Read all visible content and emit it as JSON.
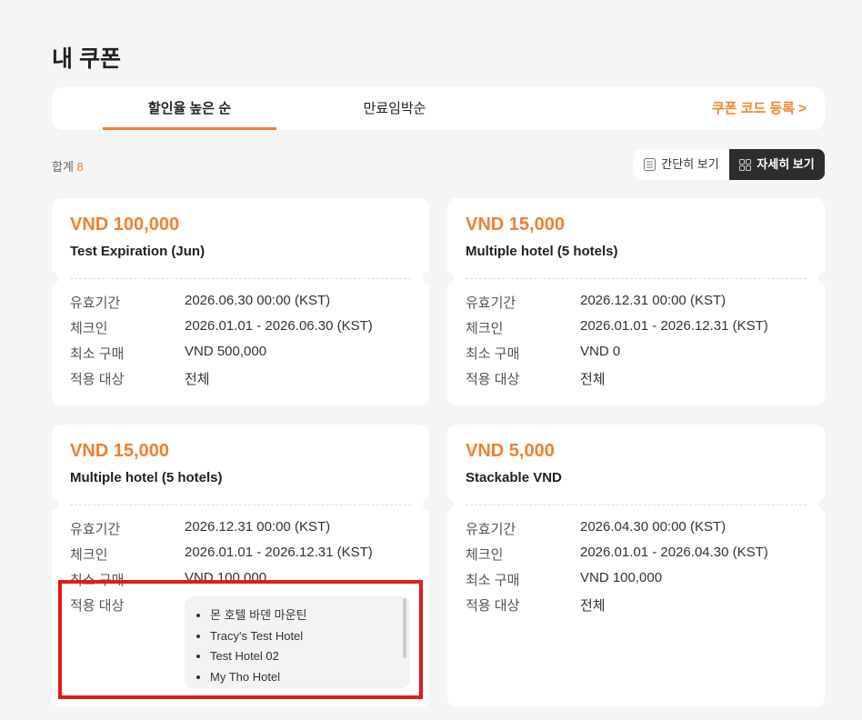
{
  "title": "내 쿠폰",
  "tabs": [
    {
      "label": "할인율 높은 순",
      "active": true
    },
    {
      "label": "만료임박순",
      "active": false
    }
  ],
  "register_label": "쿠폰 코드 등록 >",
  "total": {
    "label": "합계",
    "count": "8"
  },
  "view_toggle": {
    "simple": "간단히 보기",
    "detail": "자세히 보기"
  },
  "accent": "#f08030",
  "labels": {
    "validity": "유효기간",
    "checkin": "체크인",
    "min_purchase": "최소 구매",
    "target": "적용 대상"
  },
  "coupons": [
    {
      "amount": "VND 100,000",
      "name": "Test Expiration (Jun)",
      "validity": "2026.06.30 00:00 (KST)",
      "checkin": "2026.01.01 - 2026.06.30 (KST)",
      "min_purchase": "VND 500,000",
      "target": "전체"
    },
    {
      "amount": "VND 15,000",
      "name": "Multiple hotel (5 hotels)",
      "validity": "2026.12.31 00:00 (KST)",
      "checkin": "2026.01.01 - 2026.12.31 (KST)",
      "min_purchase": "VND 0",
      "target": "전체"
    },
    {
      "amount": "VND 15,000",
      "name": "Multiple hotel (5 hotels)",
      "validity": "2026.12.31 00:00 (KST)",
      "checkin": "2026.01.01 - 2026.12.31 (KST)",
      "min_purchase": "VND 100,000",
      "hotels": [
        "몬 호텔 바덴 마운틴",
        "Tracy's Test Hotel",
        "Test Hotel 02",
        "My Tho Hotel"
      ]
    },
    {
      "amount": "VND 5,000",
      "name": "Stackable VND",
      "validity": "2026.04.30 00:00 (KST)",
      "checkin": "2026.01.01 - 2026.04.30 (KST)",
      "min_purchase": "VND 100,000",
      "target": "전체"
    }
  ]
}
